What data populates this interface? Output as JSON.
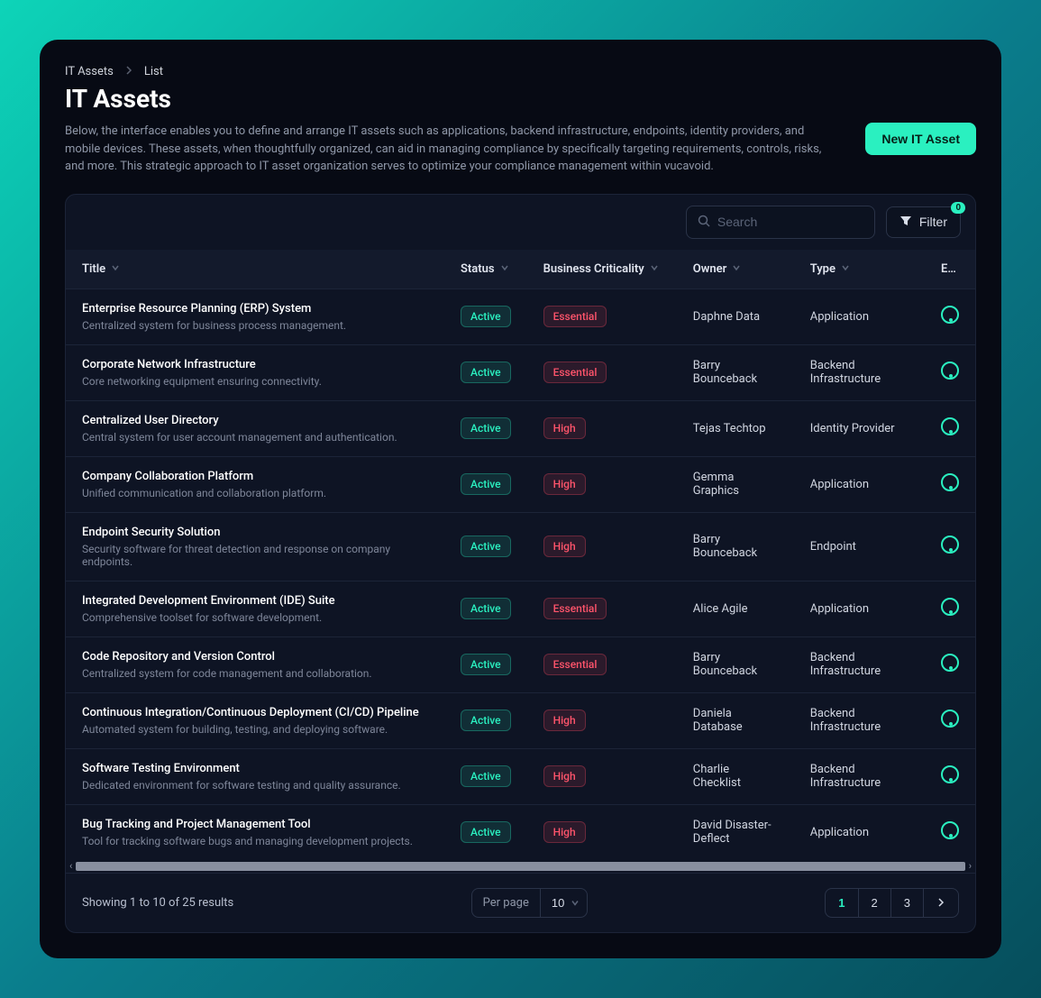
{
  "breadcrumb": {
    "root": "IT Assets",
    "leaf": "List"
  },
  "page": {
    "title": "IT Assets",
    "description": "Below, the interface enables you to define and arrange IT assets such as applications, backend infrastructure, endpoints, identity providers, and mobile devices. These assets, when thoughtfully organized, can aid in managing compliance by specifically targeting requirements, controls, risks, and more. This strategic approach to IT asset organization serves to optimize your compliance management within vucavoid."
  },
  "actions": {
    "new_label": "New IT Asset",
    "search_placeholder": "Search",
    "filter_label": "Filter",
    "filter_count": "0"
  },
  "columns": {
    "title": "Title",
    "status": "Status",
    "criticality": "Business Criticality",
    "owner": "Owner",
    "type": "Type",
    "env": "E…"
  },
  "rows": [
    {
      "title": "Enterprise Resource Planning (ERP) System",
      "sub": "Centralized system for business process management.",
      "status": "Active",
      "criticality": "Essential",
      "owner": "Daphne Data",
      "type": "Application"
    },
    {
      "title": "Corporate Network Infrastructure",
      "sub": "Core networking equipment ensuring connectivity.",
      "status": "Active",
      "criticality": "Essential",
      "owner": "Barry Bounceback",
      "type": "Backend Infrastructure"
    },
    {
      "title": "Centralized User Directory",
      "sub": "Central system for user account management and authentication.",
      "status": "Active",
      "criticality": "High",
      "owner": "Tejas Techtop",
      "type": "Identity Provider"
    },
    {
      "title": "Company Collaboration Platform",
      "sub": "Unified communication and collaboration platform.",
      "status": "Active",
      "criticality": "High",
      "owner": "Gemma Graphics",
      "type": "Application"
    },
    {
      "title": "Endpoint Security Solution",
      "sub": "Security software for threat detection and response on company endpoints.",
      "status": "Active",
      "criticality": "High",
      "owner": "Barry Bounceback",
      "type": "Endpoint"
    },
    {
      "title": "Integrated Development Environment (IDE) Suite",
      "sub": "Comprehensive toolset for software development.",
      "status": "Active",
      "criticality": "Essential",
      "owner": "Alice Agile",
      "type": "Application"
    },
    {
      "title": "Code Repository and Version Control",
      "sub": "Centralized system for code management and collaboration.",
      "status": "Active",
      "criticality": "Essential",
      "owner": "Barry Bounceback",
      "type": "Backend Infrastructure"
    },
    {
      "title": "Continuous Integration/Continuous Deployment (CI/CD) Pipeline",
      "sub": "Automated system for building, testing, and deploying software.",
      "status": "Active",
      "criticality": "High",
      "owner": "Daniela Database",
      "type": "Backend Infrastructure"
    },
    {
      "title": "Software Testing Environment",
      "sub": "Dedicated environment for software testing and quality assurance.",
      "status": "Active",
      "criticality": "High",
      "owner": "Charlie Checklist",
      "type": "Backend Infrastructure"
    },
    {
      "title": "Bug Tracking and Project Management Tool",
      "sub": "Tool for tracking software bugs and managing development projects.",
      "status": "Active",
      "criticality": "High",
      "owner": "David Disaster-Deflect",
      "type": "Application"
    }
  ],
  "pagination": {
    "summary": "Showing 1 to 10 of 25 results",
    "perpage_label": "Per page",
    "perpage_value": "10",
    "pages": [
      "1",
      "2",
      "3"
    ],
    "current": "1"
  }
}
